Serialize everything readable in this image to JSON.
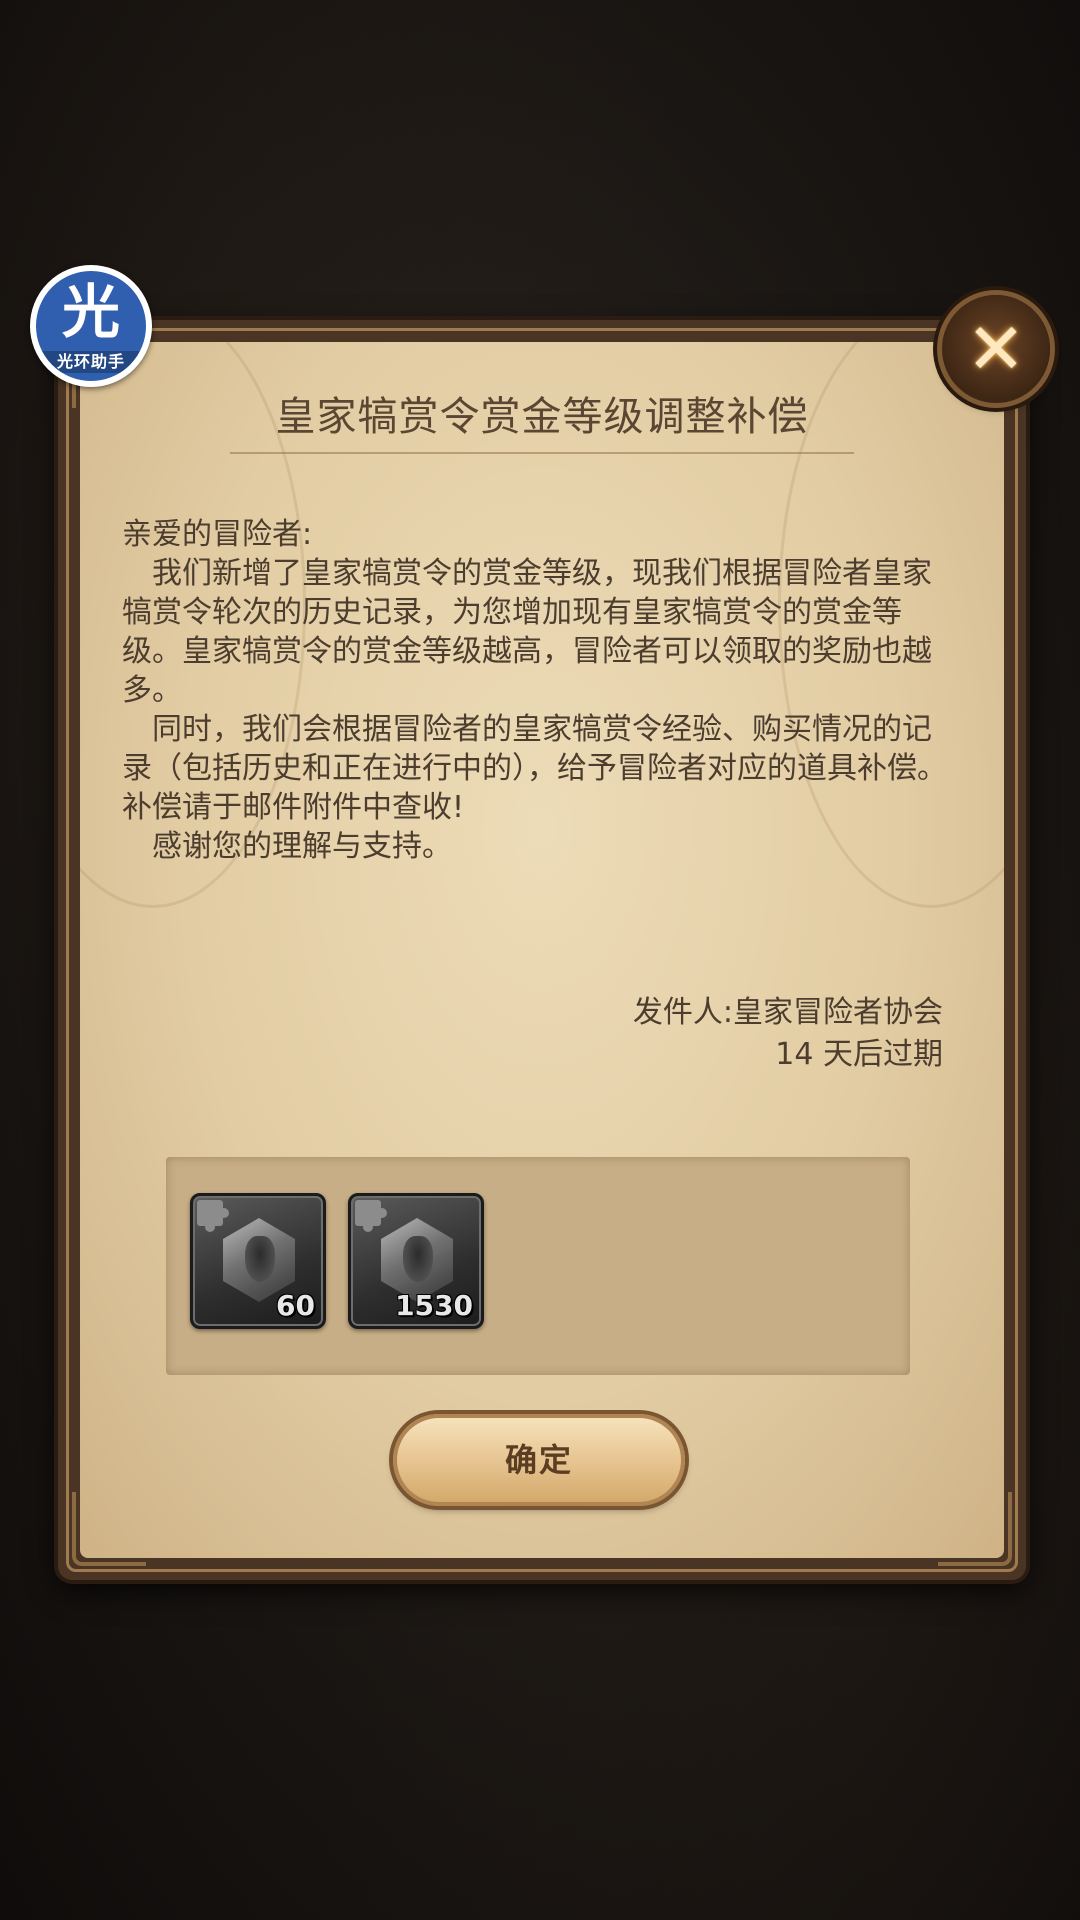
{
  "watermark": {
    "mark": "光",
    "text": "光环助手"
  },
  "dialog": {
    "title": "皇家犒赏令赏金等级调整补偿",
    "close_icon": "close-icon",
    "body": {
      "greeting": "亲爱的冒险者:",
      "paragraph1": "我们新增了皇家犒赏令的赏金等级，现我们根据冒险者皇家犒赏令轮次的历史记录，为您增加现有皇家犒赏令的赏金等级。皇家犒赏令的赏金等级越高，冒险者可以领取的奖励也越多。",
      "paragraph2": "同时，我们会根据冒险者的皇家犒赏令经验、购买情况的记录（包括历史和正在进行中的），给予冒险者对应的道具补偿。补偿请于邮件附件中查收!",
      "closing": "感谢您的理解与支持。"
    },
    "sender": "发件人:皇家冒险者协会",
    "expiry": "14 天后过期",
    "attachments": [
      {
        "icon": "hero-shard-icon",
        "count": "60"
      },
      {
        "icon": "hero-shard-icon",
        "count": "1530"
      }
    ],
    "confirm_label": "确定"
  },
  "colors": {
    "paper": "#e2cca3",
    "frame": "#4a3423",
    "text": "#4c3d2f",
    "watermark": "#2f5fae"
  }
}
